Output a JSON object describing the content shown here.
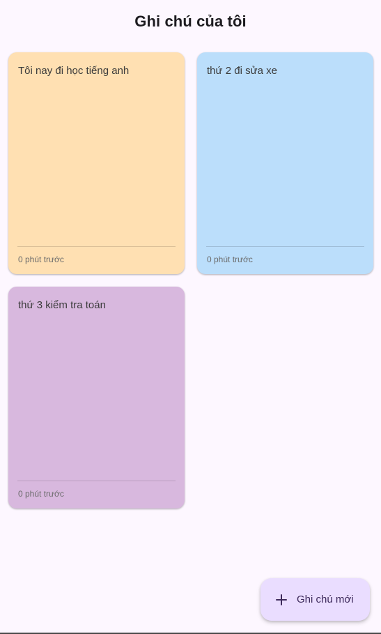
{
  "app_bar": {
    "title": "Ghi chú của tôi"
  },
  "notes": [
    {
      "text": "Tôi nay đi học tiếng anh",
      "time": "0 phút trước",
      "color": "#ffe0b2"
    },
    {
      "text": "thứ 2 đi sửa xe",
      "time": "0 phút trước",
      "color": "#bbdefb"
    },
    {
      "text": "thứ 3 kiểm tra toán",
      "time": "0 phút trước",
      "color": "#d8b8de"
    }
  ],
  "fab": {
    "icon": "plus-icon",
    "label": "Ghi chú mới",
    "color": "#eaddff"
  },
  "colors": {
    "background": "#fdf7ff",
    "fab_text": "#3d2a5c"
  }
}
